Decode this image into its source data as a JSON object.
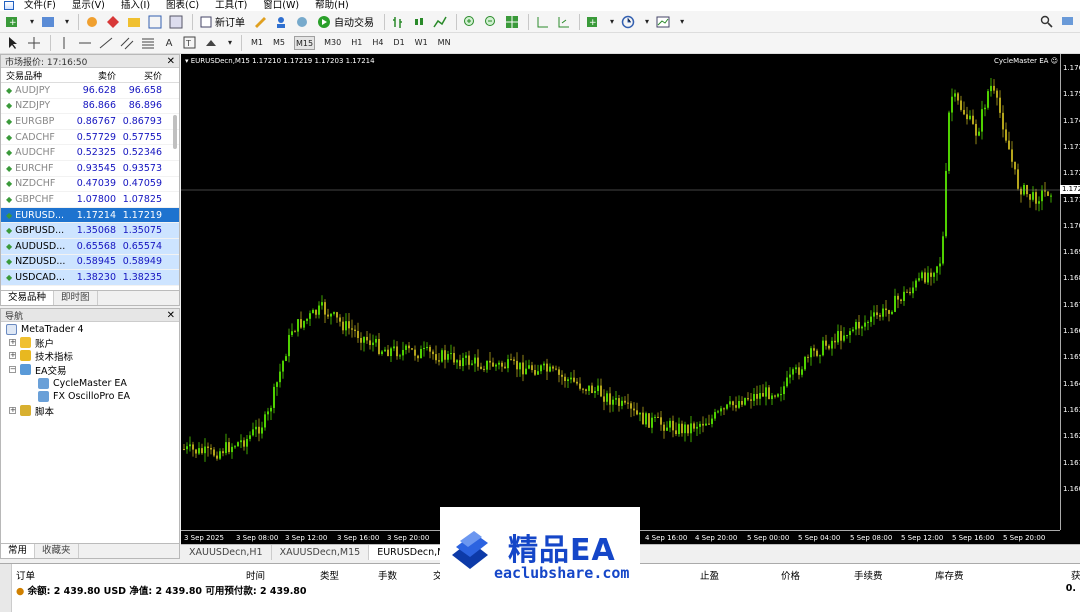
{
  "menu": [
    "文件(F)",
    "显示(V)",
    "插入(I)",
    "图表(C)",
    "工具(T)",
    "窗口(W)",
    "帮助(H)"
  ],
  "toolbar": {
    "new_order": "新订单",
    "auto_trade": "自动交易",
    "timeframes": [
      "M1",
      "M5",
      "M15",
      "M30",
      "H1",
      "H4",
      "D1",
      "W1",
      "MN"
    ],
    "active_timeframe": "M15"
  },
  "market_watch": {
    "title": "市场报价: 17:16:50",
    "headers": {
      "symbol": "交易品种",
      "bid": "卖价",
      "ask": "买价"
    },
    "rows": [
      {
        "symbol": "AUDJPY",
        "bid": "96.628",
        "ask": "96.658",
        "state": "normal"
      },
      {
        "symbol": "NZDJPY",
        "bid": "86.866",
        "ask": "86.896",
        "state": "normal"
      },
      {
        "symbol": "EURGBP",
        "bid": "0.86767",
        "ask": "0.86793",
        "state": "normal"
      },
      {
        "symbol": "CADCHF",
        "bid": "0.57729",
        "ask": "0.57755",
        "state": "normal"
      },
      {
        "symbol": "AUDCHF",
        "bid": "0.52325",
        "ask": "0.52346",
        "state": "normal"
      },
      {
        "symbol": "EURCHF",
        "bid": "0.93545",
        "ask": "0.93573",
        "state": "normal"
      },
      {
        "symbol": "NZDCHF",
        "bid": "0.47039",
        "ask": "0.47059",
        "state": "normal"
      },
      {
        "symbol": "GBPCHF",
        "bid": "1.07800",
        "ask": "1.07825",
        "state": "normal"
      },
      {
        "symbol": "EURUSD...",
        "bid": "1.17214",
        "ask": "1.17219",
        "state": "selected"
      },
      {
        "symbol": "GBPUSD...",
        "bid": "1.35068",
        "ask": "1.35075",
        "state": "highlight"
      },
      {
        "symbol": "AUDUSD...",
        "bid": "0.65568",
        "ask": "0.65574",
        "state": "highlight"
      },
      {
        "symbol": "NZDUSD...",
        "bid": "0.58945",
        "ask": "0.58949",
        "state": "highlight"
      },
      {
        "symbol": "USDCAD...",
        "bid": "1.38230",
        "ask": "1.38235",
        "state": "highlight"
      }
    ],
    "tabs": [
      "交易品种",
      "即时图"
    ]
  },
  "navigator": {
    "title": "导航",
    "root": "MetaTrader 4",
    "accounts": "账户",
    "indicators": "技术指标",
    "experts": "EA交易",
    "ea1": "CycleMaster EA",
    "ea2": "FX OscilloPro EA",
    "scripts": "脚本",
    "tabs": [
      "常用",
      "收藏夹"
    ]
  },
  "chart": {
    "info": "EURUSDecn,M15  1.17210 1.17219 1.17203 1.17214",
    "ea_label": "CycleMaster EA",
    "y_labels": [
      "1.176",
      "1.175",
      "1.174",
      "1.173",
      "1.172",
      "1.171",
      "1.170",
      "1.169",
      "1.168",
      "1.167",
      "1.166",
      "1.165",
      "1.164",
      "1.163",
      "1.162",
      "1.161",
      "1.160"
    ],
    "current_price": "1.172",
    "x_labels": [
      "3 Sep 2025",
      "3 Sep 08:00",
      "3 Sep 12:00",
      "3 Sep 16:00",
      "3 Sep 20:00",
      "4 Sep 16:00",
      "4 Sep 20:00",
      "5 Sep 00:00",
      "5 Sep 04:00",
      "5 Sep 08:00",
      "5 Sep 12:00",
      "5 Sep 16:00",
      "5 Sep 20:00"
    ],
    "bull_color": "#4fd100",
    "bear_color": "#b5a51c"
  },
  "chart_tabs": [
    "XAUUSDecn,H1",
    "XAUUSDecn,M15",
    "EURUSDecn,M"
  ],
  "terminal": {
    "headers": [
      "订单",
      "时间",
      "类型",
      "手数",
      "交",
      "止盈",
      "价格",
      "手续费",
      "库存费",
      "获"
    ],
    "balance_line": "余额: 2 439.80 USD  净值: 2 439.80  可用预付款: 2 439.80",
    "profit": "0."
  },
  "watermark": {
    "title": "精品EA",
    "url": "eaclubshare.com"
  }
}
